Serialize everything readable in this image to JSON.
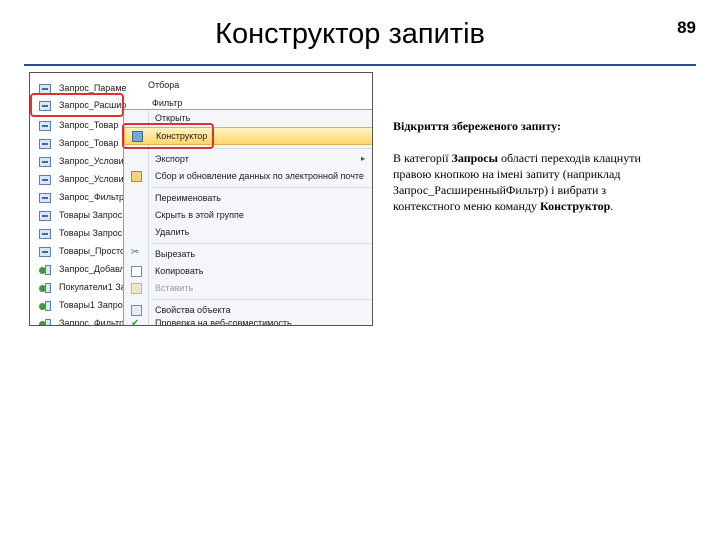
{
  "slide": {
    "title": "Конструктор запитів",
    "page_number": "89"
  },
  "navigation_pane": {
    "items": [
      {
        "label": "Запрос_ПараметрКлючевогоОтбора",
        "icon": "query-icon"
      },
      {
        "label": "Запрос_Расширенный",
        "icon": "query-icon"
      },
      {
        "label": "Запрос_Товар",
        "icon": "query-icon"
      },
      {
        "label": "Запрос_Товар",
        "icon": "query-icon"
      },
      {
        "label": "Запрос_Условие",
        "icon": "query-icon"
      },
      {
        "label": "Запрос_Условие",
        "icon": "query-icon"
      },
      {
        "label": "Запрос_Фильтр",
        "icon": "query-icon"
      },
      {
        "label": "Товары Запрос",
        "icon": "query-icon"
      },
      {
        "label": "Товары Запрос1",
        "icon": "query-icon"
      },
      {
        "label": "Товары_Просто",
        "icon": "query-icon"
      },
      {
        "label": "Запрос_Добавл",
        "icon": "append-query-icon"
      },
      {
        "label": "Покупатели1 За",
        "icon": "append-query-icon"
      },
      {
        "label": "Товары1 Запрос",
        "icon": "append-query-icon"
      },
      {
        "label": "Запрос_Фильтр",
        "icon": "append-query-icon"
      }
    ],
    "overflow_text_row1": "Отбора",
    "overflow_text_row2": "Фильтр"
  },
  "context_menu": {
    "items": [
      {
        "label": "Открыть",
        "icon": "open-icon"
      },
      {
        "label": "Конструктор",
        "icon": "design-view-icon",
        "highlighted": true
      },
      {
        "label": "Экспорт",
        "icon": "export-icon",
        "submenu": true
      },
      {
        "label": "Сбор и обновление данных по электронной почте",
        "icon": "mail-icon"
      },
      {
        "label": "Переименовать",
        "icon": ""
      },
      {
        "label": "Скрыть в этой группе",
        "icon": ""
      },
      {
        "label": "Удалить",
        "icon": ""
      },
      {
        "label": "Вырезать",
        "icon": "cut-icon"
      },
      {
        "label": "Копировать",
        "icon": "copy-icon"
      },
      {
        "label": "Вставить",
        "icon": "paste-icon",
        "disabled": true
      },
      {
        "label": "Свойства объекта",
        "icon": "properties-icon"
      },
      {
        "label": "Проверка на веб-совместимость",
        "icon": "check-icon"
      }
    ],
    "submenu_arrow": "▸"
  },
  "description": {
    "caption": "Відкриття збереженого запиту:",
    "paragraph_parts": [
      "В категорії ",
      "Запросы",
      " області переходів клацнути правою кнопкою на імені запиту (наприклад Запрос_РасширенныйФильтр) і вибрати з контекстного меню команду ",
      "Конструктор",
      "."
    ]
  },
  "colors": {
    "highlight_box": "#e03030",
    "rule": "#2c4a8c",
    "menu_highlight": "#ffd768"
  }
}
